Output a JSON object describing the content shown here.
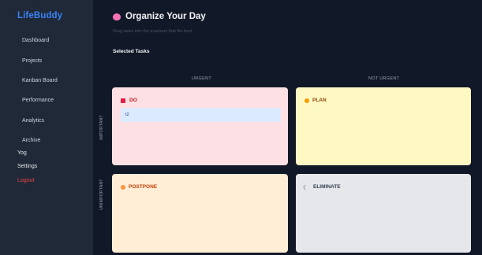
{
  "sidebar": {
    "brand": "LifeBuddy",
    "items": [
      {
        "label": "Dashboard"
      },
      {
        "label": "Projects"
      },
      {
        "label": "Kanban Board"
      },
      {
        "label": "Performance"
      },
      {
        "label": "Analytics"
      },
      {
        "label": "Archive"
      }
    ],
    "extra": [
      {
        "label": "Yog"
      },
      {
        "label": "Settings"
      },
      {
        "label": "Logout"
      }
    ]
  },
  "header": {
    "title": "Organize Your Day",
    "subtitle": "Drag tasks into the quadrant that fits best.",
    "selected_label": "Selected Tasks"
  },
  "matrix": {
    "columns": [
      "URGENT",
      "NOT URGENT"
    ],
    "rows": [
      "IMPORTANT",
      "UNIMPORTANT"
    ],
    "quadrants": {
      "do": {
        "label": "DO",
        "tasks": [
          "t2"
        ]
      },
      "plan": {
        "label": "PLAN"
      },
      "postpone": {
        "label": "POSTPONE"
      },
      "eliminate": {
        "label": "ELIMINATE"
      }
    }
  },
  "colors": {
    "background": "#111827",
    "sidebar": "#1f2937",
    "brand": "#3b82f6",
    "logout": "#ef4444",
    "do": "#fde0e3",
    "plan": "#fef9c3",
    "postpone": "#ffedd5",
    "eliminate": "#e5e7eb"
  }
}
